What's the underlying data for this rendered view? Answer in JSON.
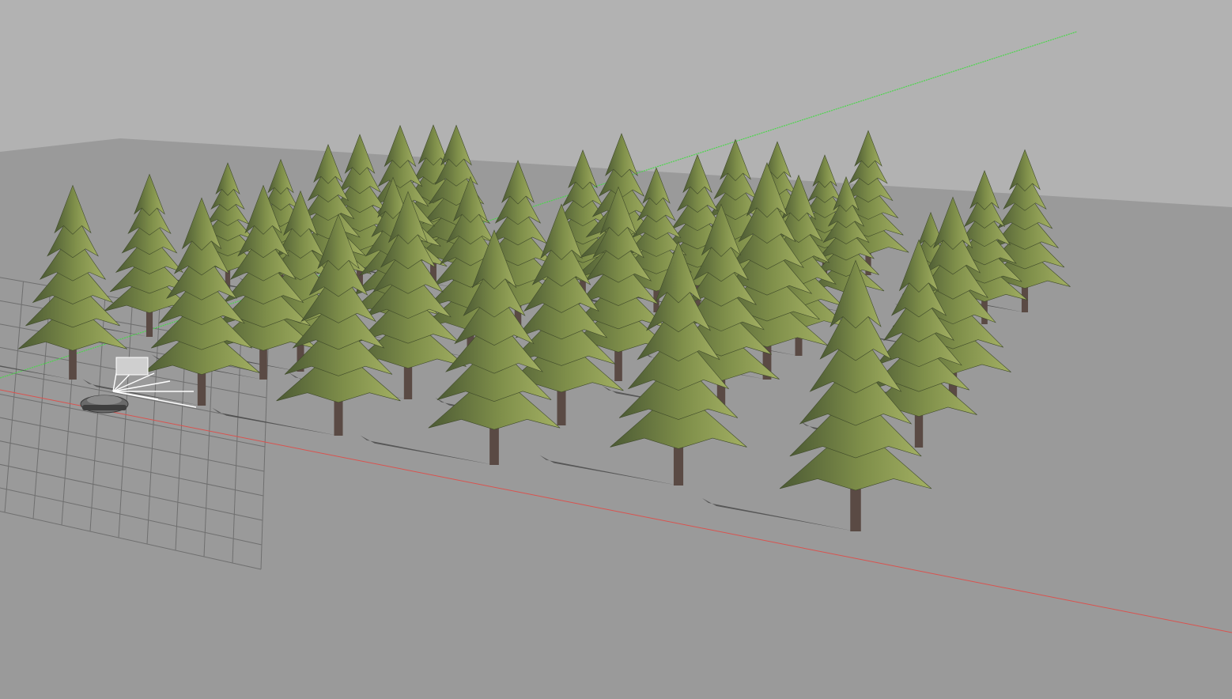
{
  "scene": {
    "sky_color": "#b2b2b2",
    "ground_color": "#9a9a9a",
    "grid_color": "#6e6e6e",
    "axis_x_color": "#d9534f",
    "axis_y_color": "#4cd64c",
    "tree_dark_color": "#4c5a34",
    "tree_light_color": "#93a257",
    "trunk_color": "#5a4a44",
    "shadow_color": "#4a4a4a",
    "robot_color": "#6a6a6a",
    "sensor_ray_color": "#ffffff"
  },
  "objects": {
    "ground_plane": "ground-plane",
    "reference_grid": "grid-10x10",
    "x_axis": "x-axis-line",
    "y_axis": "y-axis-line",
    "forest": "pine-tree-grid",
    "robot": "tracked-robot",
    "sensor": "lidar-rays"
  }
}
